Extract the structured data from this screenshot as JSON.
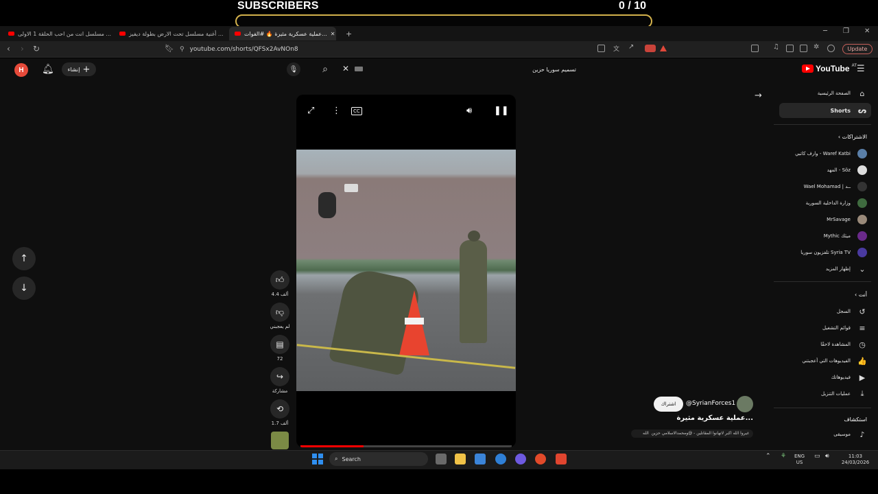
{
  "overlay": {
    "title": "SUBSCRIBERS",
    "count": "0  / 10",
    "progress_fraction": 0.0,
    "accent": "#d4b24c"
  },
  "browser": {
    "tabs": [
      {
        "label": "مسلسل انت من احب الحلقة 1 الاولى ...",
        "active": false
      },
      {
        "label": "أغنية مسلسل تحت الارض بطولة ديفيز ...",
        "active": false
      },
      {
        "label": "عملية عسكرية مثيرة 🔥 #الفوات...",
        "active": true
      }
    ],
    "new_tab": "+",
    "url": "youtube.com/shorts/QFSx2AvNOn8",
    "update_label": "Update"
  },
  "header": {
    "avatar_letter": "H",
    "create_label": "إنشاء",
    "search_value": "تسميم سوريا حزين",
    "logo_text": "YouTube",
    "country_code": "AT"
  },
  "actions": {
    "likes": "4.4 ألف",
    "dislike_label": "لم يعجبني",
    "comments": "72",
    "share_label": "مشاركة",
    "remix": "1.7 ألف"
  },
  "short": {
    "channel": "@SyrianForces1",
    "subscribe_label": "اشتراك",
    "title": "عملية عسكرية مثيرة...",
    "description": "الله ‎ غيروا الله اكبر لاتهانوا المقاتلين - @ومحمدالاسلامي حزين"
  },
  "guide": {
    "home": "الصفحة الرئيسية",
    "shorts": "Shorts",
    "subscriptions_header": "الاشتراكات",
    "subscriptions": [
      {
        "label": "وارف كاتبي - Waref Katbi",
        "color": "#5a7fa8"
      },
      {
        "label": "المهد - Söz",
        "color": "#dddddd"
      },
      {
        "label": "Wael Mohamad | ــد",
        "color": "#333333"
      },
      {
        "label": "وزارة الداخلية السورية",
        "color": "#3f6b3f"
      },
      {
        "label": "MrSavage",
        "color": "#9a8a7a"
      },
      {
        "label": "Mythic ميثك",
        "color": "#6a2a8a"
      },
      {
        "label": "تلفزيون سوريا Syria TV",
        "color": "#4a3aa0"
      }
    ],
    "show_more": "إظهار المزيد",
    "you_header": "أنت",
    "you_items": [
      {
        "label": "السجل",
        "icon": "history-icon",
        "glyph": "↺"
      },
      {
        "label": "قوائم التشغيل",
        "icon": "playlists-icon",
        "glyph": "≡"
      },
      {
        "label": "المشاهدة لاحقًا",
        "icon": "watch-later-icon",
        "glyph": "◷"
      },
      {
        "label": "الفيديوهات التي أعجبتني",
        "icon": "liked-icon",
        "glyph": "👍"
      },
      {
        "label": "فيديوهاتك",
        "icon": "your-videos-icon",
        "glyph": "▶"
      },
      {
        "label": "عمليات التنزيل",
        "icon": "downloads-icon",
        "glyph": "⤓"
      }
    ],
    "explore_header": "استكشاف",
    "explore_items": [
      {
        "label": "موسيقى",
        "icon": "music-icon",
        "glyph": "♪"
      }
    ]
  },
  "taskbar": {
    "search_label": "Search",
    "lang_top": "ENG",
    "lang_bottom": "US",
    "time": "11:03",
    "date": "24/03/2026"
  }
}
